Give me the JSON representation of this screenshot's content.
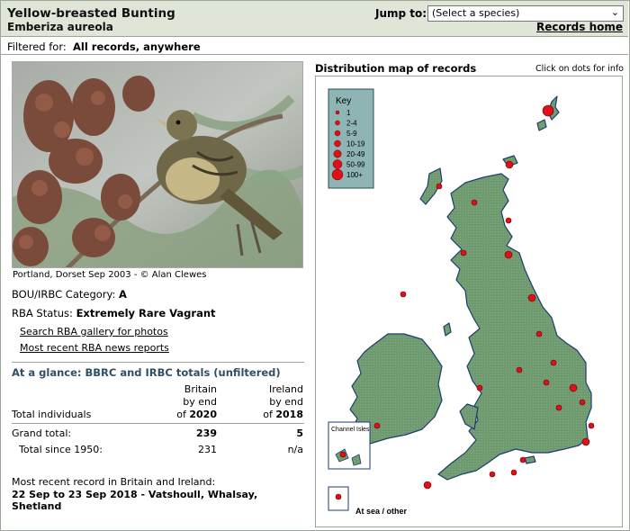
{
  "header": {
    "common_name": "Yellow-breasted Bunting",
    "latin_name": "Emberiza aureola",
    "jump_label": "Jump to:",
    "jump_selected": "(Select a species)",
    "records_home": "Records home"
  },
  "filter": {
    "label": "Filtered for:",
    "value": "All records, anywhere"
  },
  "photo": {
    "caption": "Portland, Dorset Sep 2003 - © Alan Clewes"
  },
  "status": {
    "category_label": "BOU/IRBC Category:",
    "category_value": "A",
    "rba_label": "RBA Status:",
    "rba_value": "Extremely Rare Vagrant"
  },
  "links": {
    "gallery": "Search RBA gallery for photos",
    "news": "Most recent RBA news reports"
  },
  "glance": {
    "title": "At a glance: BBRC and IRBC totals (unfiltered)",
    "britain_head_1": "Britain",
    "britain_head_2": "by end",
    "britain_head_3_prefix": "of",
    "britain_year": "2020",
    "ireland_head_1": "Ireland",
    "ireland_head_2": "by end",
    "ireland_head_3_prefix": "of",
    "ireland_year": "2018",
    "total_individuals": "Total individuals",
    "grand_total_label": "Grand total:",
    "grand_total_britain": "239",
    "grand_total_ireland": "5",
    "since_label": "Total since 1950:",
    "since_britain": "231",
    "since_ireland": "n/a"
  },
  "recent": {
    "label": "Most recent record in Britain and Ireland:",
    "value": "22 Sep to 23 Sep 2018 - Vatshoull, Whalsay, Shetland"
  },
  "map": {
    "title": "Distribution map of records",
    "hint": "Click on dots for info",
    "key_title": "Key",
    "key_items": [
      "1",
      "2-4",
      "5-9",
      "10-19",
      "20-49",
      "50-99",
      "100+"
    ],
    "channel_isles": "Channel Isles",
    "at_sea": "At sea / other",
    "land_color": "#6f9a6f",
    "dot_color": "#e0101a"
  }
}
